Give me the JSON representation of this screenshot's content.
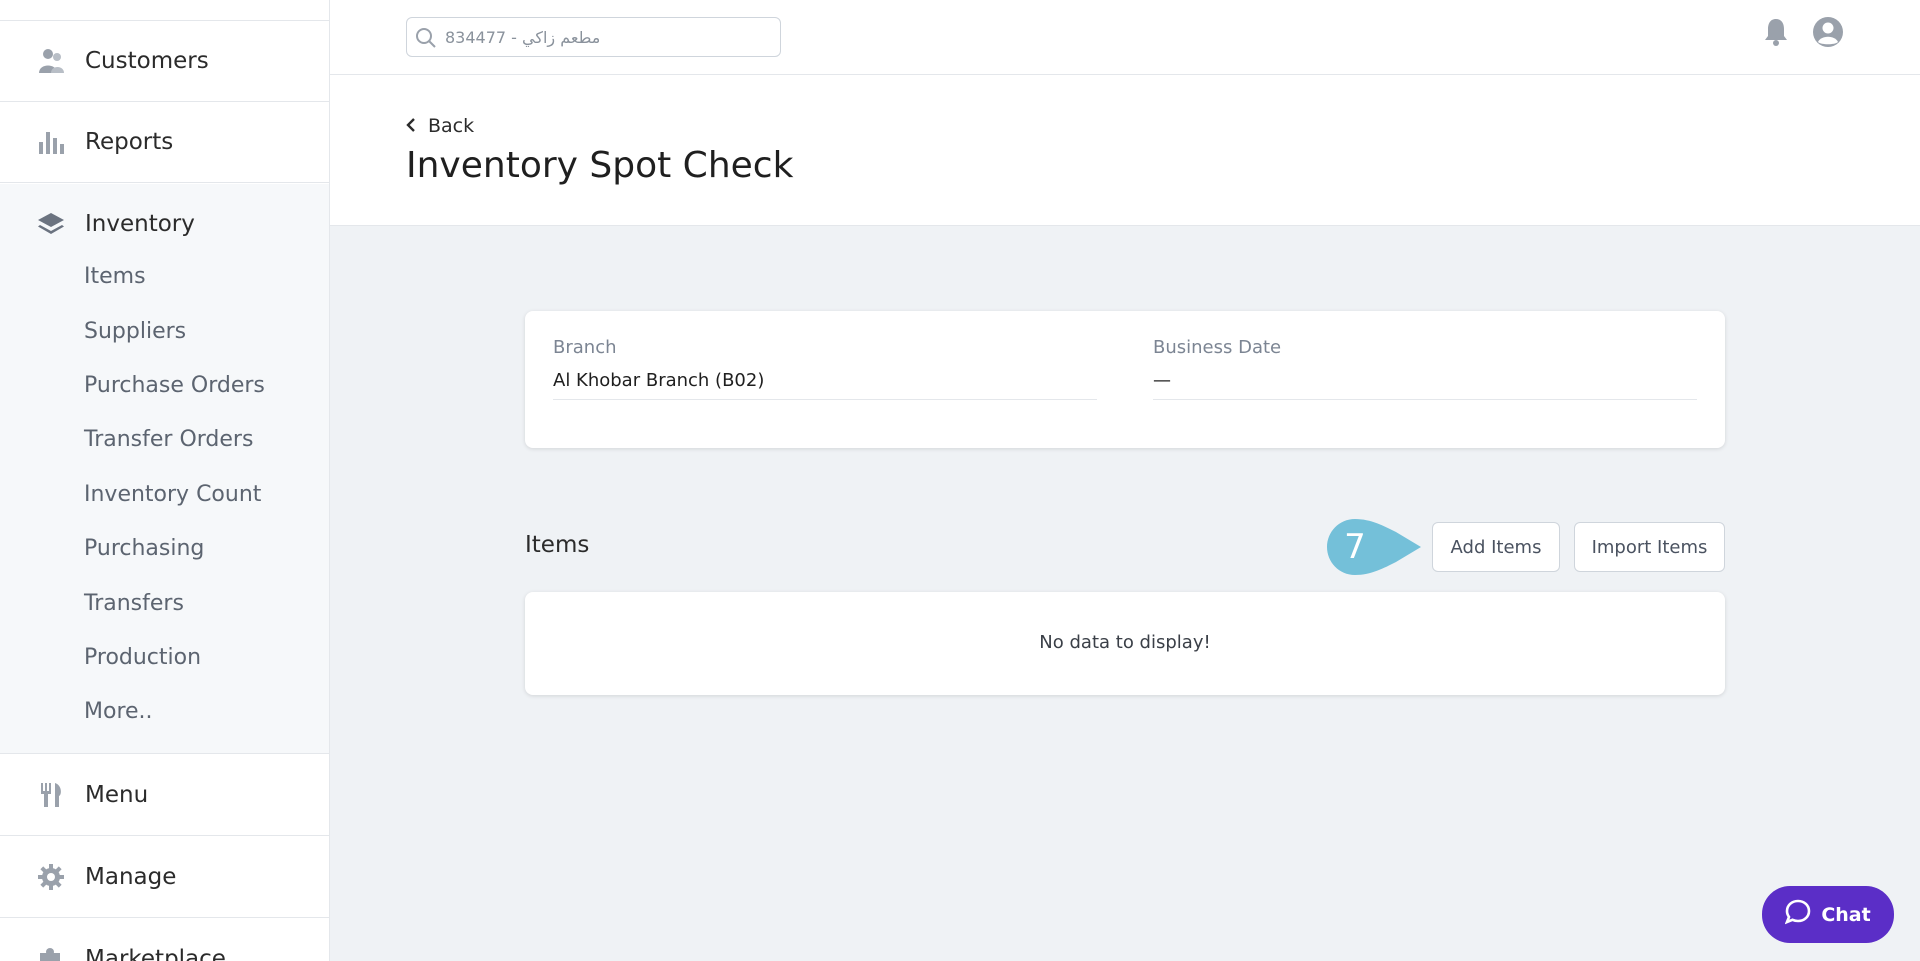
{
  "sidebar": {
    "customers": "Customers",
    "reports": "Reports",
    "inventory": "Inventory",
    "inventory_sub": [
      "Items",
      "Suppliers",
      "Purchase Orders",
      "Transfer Orders",
      "Inventory Count",
      "Purchasing",
      "Transfers",
      "Production",
      "More.."
    ],
    "menu": "Menu",
    "manage": "Manage",
    "marketplace": "Marketplace"
  },
  "topbar": {
    "search_value": "834477 - مطعم زاكي"
  },
  "header": {
    "back_label": "Back",
    "title": "Inventory Spot Check"
  },
  "details": {
    "branch_label": "Branch",
    "branch_value": "Al Khobar Branch (B02)",
    "business_date_label": "Business Date",
    "business_date_value": "—"
  },
  "items_section": {
    "title": "Items",
    "add_items": "Add Items",
    "import_items": "Import Items",
    "empty": "No data to display!",
    "step_badge": "7"
  },
  "chat": {
    "label": "Chat"
  },
  "colors": {
    "accent_purple": "#5b2ec7",
    "step_badge": "#74c0d9",
    "icon_gray": "#9aa1ab"
  }
}
